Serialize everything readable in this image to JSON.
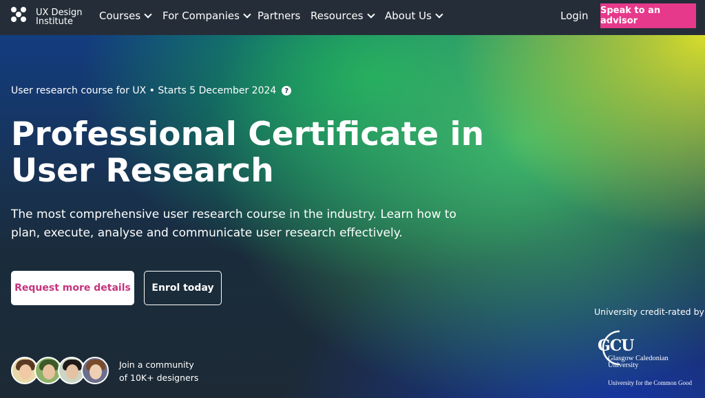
{
  "brand": {
    "line1": "UX Design",
    "line2": "Institute"
  },
  "nav": {
    "items": [
      {
        "label": "Courses",
        "dropdown": true
      },
      {
        "label": "For Companies",
        "dropdown": true
      },
      {
        "label": "Partners",
        "dropdown": false
      },
      {
        "label": "Resources",
        "dropdown": true
      },
      {
        "label": "About Us",
        "dropdown": true
      }
    ],
    "login": "Login",
    "cta": "Speak to an advisor"
  },
  "hero": {
    "eyebrow": "User research course for UX • Starts 5 December 2024",
    "help_icon": "?",
    "title_line1": "Professional Certificate in",
    "title_line2": "User Research",
    "description": "The most comprehensive user research course in the industry. Learn how to plan, execute, analyse and communicate user research effectively.",
    "primary_button": "Request more details",
    "secondary_button": "Enrol today",
    "community_line1": "Join a community",
    "community_line2": "of 10K+ designers",
    "credit_label": "University credit-rated by"
  },
  "partner": {
    "letters": "GCU",
    "name_line1": "Glasgow Caledonian",
    "name_line2": "University",
    "tagline": "University for the Common Good"
  },
  "colors": {
    "nav_bg": "#252e38",
    "cta_pink": "#e6398b",
    "primary_text": "#c5337d"
  }
}
